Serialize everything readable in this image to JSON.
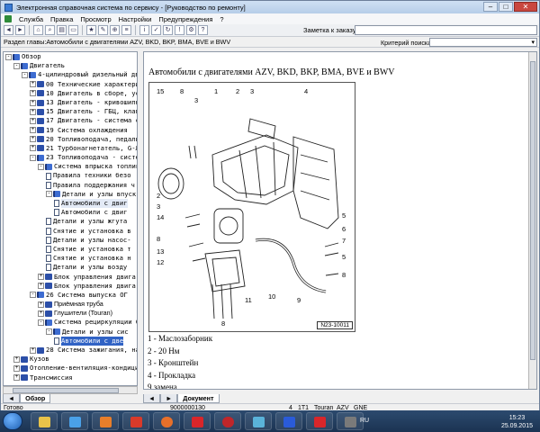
{
  "window": {
    "title": "Электронная справочная система по сервису - [Руководство по ремонту]"
  },
  "menu": [
    "Служба",
    "Правка",
    "Просмотр",
    "Настройки",
    "Предупреждения",
    "?"
  ],
  "toolbar": {
    "order_label": "Заметка к заказу:"
  },
  "section": {
    "text": "Раздел главы:Автомобили с двигателями AZV, BKD, BKP, BMA, BVE и BWV",
    "criteria_label": "Критерий поиска:"
  },
  "tree": [
    {
      "text": "Обзор",
      "indent": 0,
      "exp": "-",
      "icon": "book-open"
    },
    {
      "text": "Двигатель",
      "indent": 1,
      "exp": "-",
      "icon": "book-open"
    },
    {
      "text": "4-цилиндровый дизельный двигател",
      "indent": 2,
      "exp": "-",
      "icon": "book-open"
    },
    {
      "text": "00 Технические характеристики",
      "indent": 3,
      "exp": "+",
      "icon": "book"
    },
    {
      "text": "10 Двигатель в сборе, ус",
      "indent": 3,
      "exp": "+",
      "icon": "book"
    },
    {
      "text": "13 Двигатель - кривошипн",
      "indent": 3,
      "exp": "+",
      "icon": "book"
    },
    {
      "text": "15 Двигатель - ГБЦ, клап",
      "indent": 3,
      "exp": "+",
      "icon": "book"
    },
    {
      "text": "17 Двигатель - система с",
      "indent": 3,
      "exp": "+",
      "icon": "book"
    },
    {
      "text": "19 Система охлаждения",
      "indent": 3,
      "exp": "+",
      "icon": "book"
    },
    {
      "text": "20 Топливоподача, педаль",
      "indent": 3,
      "exp": "+",
      "icon": "book"
    },
    {
      "text": "21 Турбонагнетатель, G-Л",
      "indent": 3,
      "exp": "+",
      "icon": "book"
    },
    {
      "text": "23 Топливоподача - систем",
      "indent": 3,
      "exp": "-",
      "icon": "book-open"
    },
    {
      "text": "Система впрыска топлива",
      "indent": 4,
      "exp": "-",
      "icon": "book-open"
    },
    {
      "text": "Правила техники безо",
      "indent": 5,
      "exp": "",
      "icon": "page"
    },
    {
      "text": "Правила поддержания ч",
      "indent": 5,
      "exp": "",
      "icon": "page"
    },
    {
      "text": "Детали и узлы впуск",
      "indent": 5,
      "exp": "-",
      "icon": "book-open"
    },
    {
      "text": "Автомобили с двиг",
      "indent": 6,
      "exp": "",
      "icon": "page",
      "state": "hl"
    },
    {
      "text": "Автомобили с двиг",
      "indent": 6,
      "exp": "",
      "icon": "page"
    },
    {
      "text": "Детали и узлы жгута",
      "indent": 5,
      "exp": "",
      "icon": "page"
    },
    {
      "text": "Снятие и установка в",
      "indent": 5,
      "exp": "",
      "icon": "page"
    },
    {
      "text": "Детали и узлы насос-",
      "indent": 5,
      "exp": "",
      "icon": "page"
    },
    {
      "text": "Снятие и установка т",
      "indent": 5,
      "exp": "",
      "icon": "page"
    },
    {
      "text": "Снятие и установка н",
      "indent": 5,
      "exp": "",
      "icon": "page"
    },
    {
      "text": "Детали и узлы возду",
      "indent": 5,
      "exp": "",
      "icon": "page"
    },
    {
      "text": "Блок управления двига",
      "indent": 4,
      "exp": "+",
      "icon": "book"
    },
    {
      "text": "Блок управления двига",
      "indent": 4,
      "exp": "+",
      "icon": "book"
    },
    {
      "text": "26 Система выпуска ОГ",
      "indent": 3,
      "exp": "-",
      "icon": "book-open"
    },
    {
      "text": "Приёмная труба",
      "indent": 4,
      "exp": "+",
      "icon": "book",
      "sans": true
    },
    {
      "text": "Глушители (Touran)",
      "indent": 4,
      "exp": "+",
      "icon": "book",
      "sans": true
    },
    {
      "text": "Система рециркуляции ОГ",
      "indent": 4,
      "exp": "-",
      "icon": "book-open"
    },
    {
      "text": "Детали и узлы сис",
      "indent": 5,
      "exp": "-",
      "icon": "book-open"
    },
    {
      "text": "Автомобили с две",
      "indent": 6,
      "exp": "",
      "icon": "page",
      "state": "sel"
    },
    {
      "text": "28 Система зажигания, на",
      "indent": 3,
      "exp": "+",
      "icon": "book"
    },
    {
      "text": "Кузов",
      "indent": 1,
      "exp": "+",
      "icon": "book"
    },
    {
      "text": "Отопление-вентиляция-кондиционир",
      "indent": 1,
      "exp": "+",
      "icon": "book"
    },
    {
      "text": "Трансмиссия",
      "indent": 1,
      "exp": "+",
      "icon": "book"
    }
  ],
  "left_tab": "Обзор",
  "right_tab": "Документ",
  "document": {
    "title": "Автомобили с двигателями AZV, BKD, BKP, BMA, BVE и BWV",
    "diagram_code": "N23-10011",
    "callouts": [
      "15",
      "8",
      "3",
      "1",
      "2",
      "3",
      "4",
      "2",
      "3",
      "14",
      "8",
      "13",
      "12",
      "5",
      "6",
      "7",
      "8",
      "11",
      "10",
      "9",
      "5",
      "8"
    ],
    "legend": [
      "1 -  Маслозаборник",
      "2 -  20 Нм",
      "3 -  Кронштейн",
      "4 -  Прокладка",
      "9    замена"
    ]
  },
  "status": {
    "ready": "Готово",
    "code": "9000000130",
    "page": "4",
    "model": "1T1",
    "make": "Touran",
    "eng1": "AZV",
    "eng2": "GNE"
  },
  "taskbar": {
    "lang": "RU",
    "time": "15:23",
    "date": "25.09.2015"
  },
  "colors": {
    "selection": "#3163c5",
    "title_bar": "#b6cde8",
    "taskbar": "#1b3352"
  }
}
